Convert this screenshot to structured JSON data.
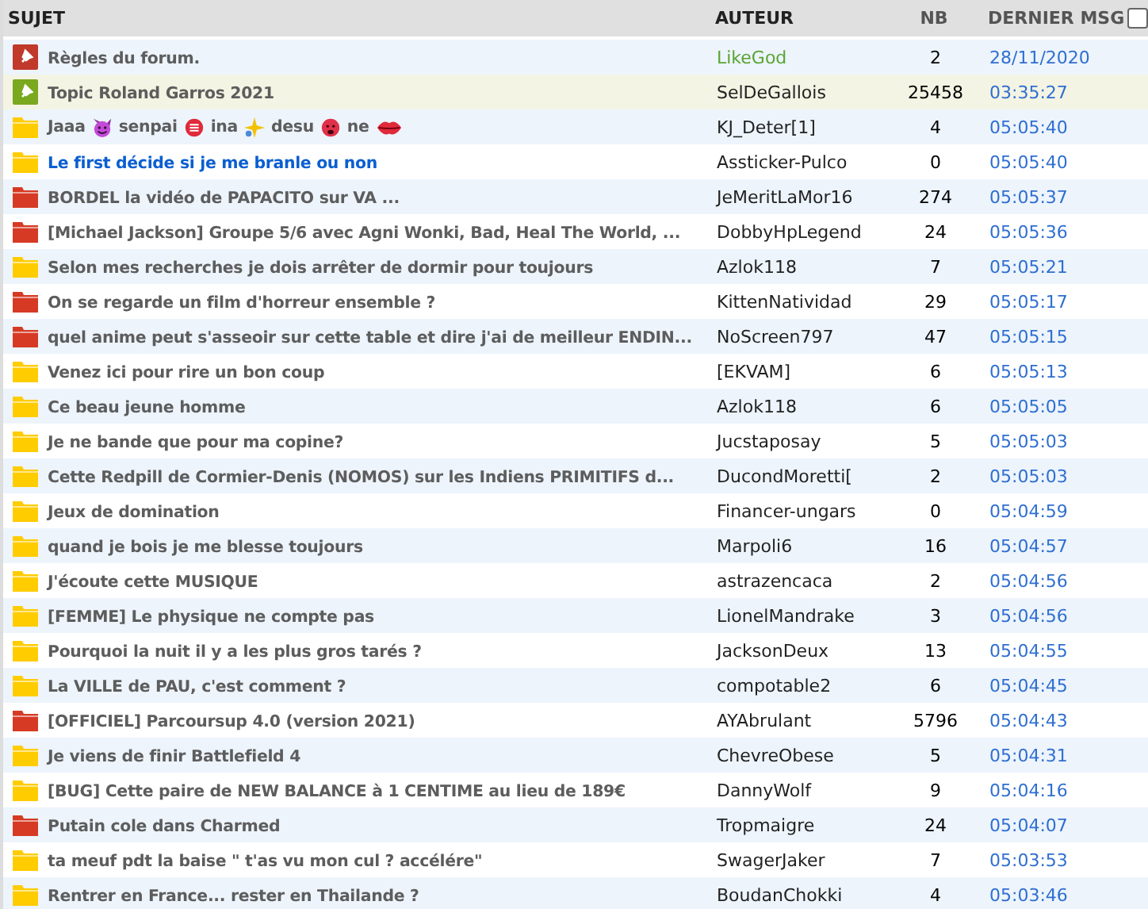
{
  "header": {
    "subject": "SUJET",
    "author": "AUTEUR",
    "count": "NB",
    "last": "DERNIER MSG",
    "select_all": {
      "checked": false
    }
  },
  "topics": [
    {
      "kind": "pin",
      "color": "#c0392b",
      "title": "Règles du forum.",
      "read": true,
      "highlighted": false,
      "author": "LikeGod",
      "moderator": true,
      "count": "2",
      "last": "28/11/2020"
    },
    {
      "kind": "pin",
      "color": "#7aa81e",
      "title": "Topic Roland Garros 2021",
      "read": true,
      "highlighted": true,
      "author": "SelDeGallois",
      "moderator": false,
      "count": "25458",
      "last": "03:35:27"
    },
    {
      "kind": "folder",
      "color": "#ffcc00",
      "title_parts": [
        "Jaaa",
        "senpai",
        "ina",
        "desu",
        "ne"
      ],
      "read": true,
      "highlighted": false,
      "author": "KJ_Deter[1]",
      "moderator": false,
      "count": "4",
      "last": "05:05:40"
    },
    {
      "kind": "folder",
      "color": "#ffcc00",
      "title": "Le first décide si je me branle ou non",
      "read": false,
      "highlighted": false,
      "author": "Assticker-Pulco",
      "moderator": false,
      "count": "0",
      "last": "05:05:40"
    },
    {
      "kind": "folder",
      "color": "#d63a24",
      "title": "BORDEL la vidéo de PAPACITO sur VA ...",
      "read": true,
      "highlighted": false,
      "author": "JeMeritLaMor16",
      "moderator": false,
      "count": "274",
      "last": "05:05:37"
    },
    {
      "kind": "folder",
      "color": "#d63a24",
      "title": "[Michael Jackson] Groupe 5/6 avec Agni Wonki, Bad, Heal The World, ...",
      "read": true,
      "highlighted": false,
      "author": "DobbyHpLegend",
      "moderator": false,
      "count": "24",
      "last": "05:05:36"
    },
    {
      "kind": "folder",
      "color": "#ffcc00",
      "title": "Selon mes recherches je dois arrêter de dormir pour toujours",
      "read": true,
      "highlighted": false,
      "author": "Azlok118",
      "moderator": false,
      "count": "7",
      "last": "05:05:21"
    },
    {
      "kind": "folder",
      "color": "#d63a24",
      "title": "On se regarde un film d'horreur ensemble ?",
      "read": true,
      "highlighted": false,
      "author": "KittenNatividad",
      "moderator": false,
      "count": "29",
      "last": "05:05:17"
    },
    {
      "kind": "folder",
      "color": "#d63a24",
      "title": "quel anime peut s'asseoir sur cette table et dire j'ai de meilleur ENDIN...",
      "read": true,
      "highlighted": false,
      "author": "NoScreen797",
      "moderator": false,
      "count": "47",
      "last": "05:05:15"
    },
    {
      "kind": "folder",
      "color": "#ffcc00",
      "title": "Venez ici pour rire un bon coup",
      "read": true,
      "highlighted": false,
      "author": "[EKVAM]",
      "moderator": false,
      "count": "6",
      "last": "05:05:13"
    },
    {
      "kind": "folder",
      "color": "#ffcc00",
      "title": "Ce beau jeune homme",
      "read": true,
      "highlighted": false,
      "author": "Azlok118",
      "moderator": false,
      "count": "6",
      "last": "05:05:05"
    },
    {
      "kind": "folder",
      "color": "#ffcc00",
      "title": "Je ne bande que pour ma copine?",
      "read": true,
      "highlighted": false,
      "author": "Jucstaposay",
      "moderator": false,
      "count": "5",
      "last": "05:05:03"
    },
    {
      "kind": "folder",
      "color": "#ffcc00",
      "title": "Cette Redpill de Cormier-Denis (NOMOS) sur les Indiens PRIMITIFS d...",
      "read": true,
      "highlighted": false,
      "author": "DucondMoretti[",
      "moderator": false,
      "count": "2",
      "last": "05:05:03"
    },
    {
      "kind": "folder",
      "color": "#ffcc00",
      "title": "Jeux de domination",
      "read": true,
      "highlighted": false,
      "author": "Financer-ungars",
      "moderator": false,
      "count": "0",
      "last": "05:04:59"
    },
    {
      "kind": "folder",
      "color": "#ffcc00",
      "title": "quand je bois je me blesse toujours",
      "read": true,
      "highlighted": false,
      "author": "Marpoli6",
      "moderator": false,
      "count": "16",
      "last": "05:04:57"
    },
    {
      "kind": "folder",
      "color": "#ffcc00",
      "title": "J'écoute cette MUSIQUE",
      "read": true,
      "highlighted": false,
      "author": "astrazencaca",
      "moderator": false,
      "count": "2",
      "last": "05:04:56"
    },
    {
      "kind": "folder",
      "color": "#ffcc00",
      "title": "[FEMME] Le physique ne compte pas",
      "read": true,
      "highlighted": false,
      "author": "LionelMandrake",
      "moderator": false,
      "count": "3",
      "last": "05:04:56"
    },
    {
      "kind": "folder",
      "color": "#ffcc00",
      "title": "Pourquoi la nuit il y a les plus gros tarés ?",
      "read": true,
      "highlighted": false,
      "author": "JacksonDeux",
      "moderator": false,
      "count": "13",
      "last": "05:04:55"
    },
    {
      "kind": "folder",
      "color": "#ffcc00",
      "title": "La VILLE de PAU, c'est comment ?",
      "read": true,
      "highlighted": false,
      "author": "compotable2",
      "moderator": false,
      "count": "6",
      "last": "05:04:45"
    },
    {
      "kind": "folder",
      "color": "#d63a24",
      "title": "[OFFICIEL] Parcoursup 4.0 (version 2021)",
      "read": true,
      "highlighted": false,
      "author": "AYAbrulant",
      "moderator": false,
      "count": "5796",
      "last": "05:04:43"
    },
    {
      "kind": "folder",
      "color": "#ffcc00",
      "title": "Je viens de finir Battlefield 4",
      "read": true,
      "highlighted": false,
      "author": "ChevreObese",
      "moderator": false,
      "count": "5",
      "last": "05:04:31"
    },
    {
      "kind": "folder",
      "color": "#ffcc00",
      "title": "[BUG] Cette paire de NEW BALANCE à 1 CENTIME au lieu de 189€",
      "read": true,
      "highlighted": false,
      "author": "DannyWolf",
      "moderator": false,
      "count": "9",
      "last": "05:04:16"
    },
    {
      "kind": "folder",
      "color": "#d63a24",
      "title": "Putain cole dans Charmed",
      "read": true,
      "highlighted": false,
      "author": "Tropmaigre",
      "moderator": false,
      "count": "24",
      "last": "05:04:07"
    },
    {
      "kind": "folder",
      "color": "#ffcc00",
      "title": "ta meuf pdt la baise \" t'as vu mon cul ? accélére\"",
      "read": true,
      "highlighted": false,
      "author": "SwagerJaker",
      "moderator": false,
      "count": "7",
      "last": "05:03:53"
    },
    {
      "kind": "folder",
      "color": "#ffcc00",
      "title": "Rentrer en France... rester en Thailande ?",
      "read": true,
      "highlighted": false,
      "author": "BoudanChokki",
      "moderator": false,
      "count": "4",
      "last": "05:03:46"
    }
  ]
}
